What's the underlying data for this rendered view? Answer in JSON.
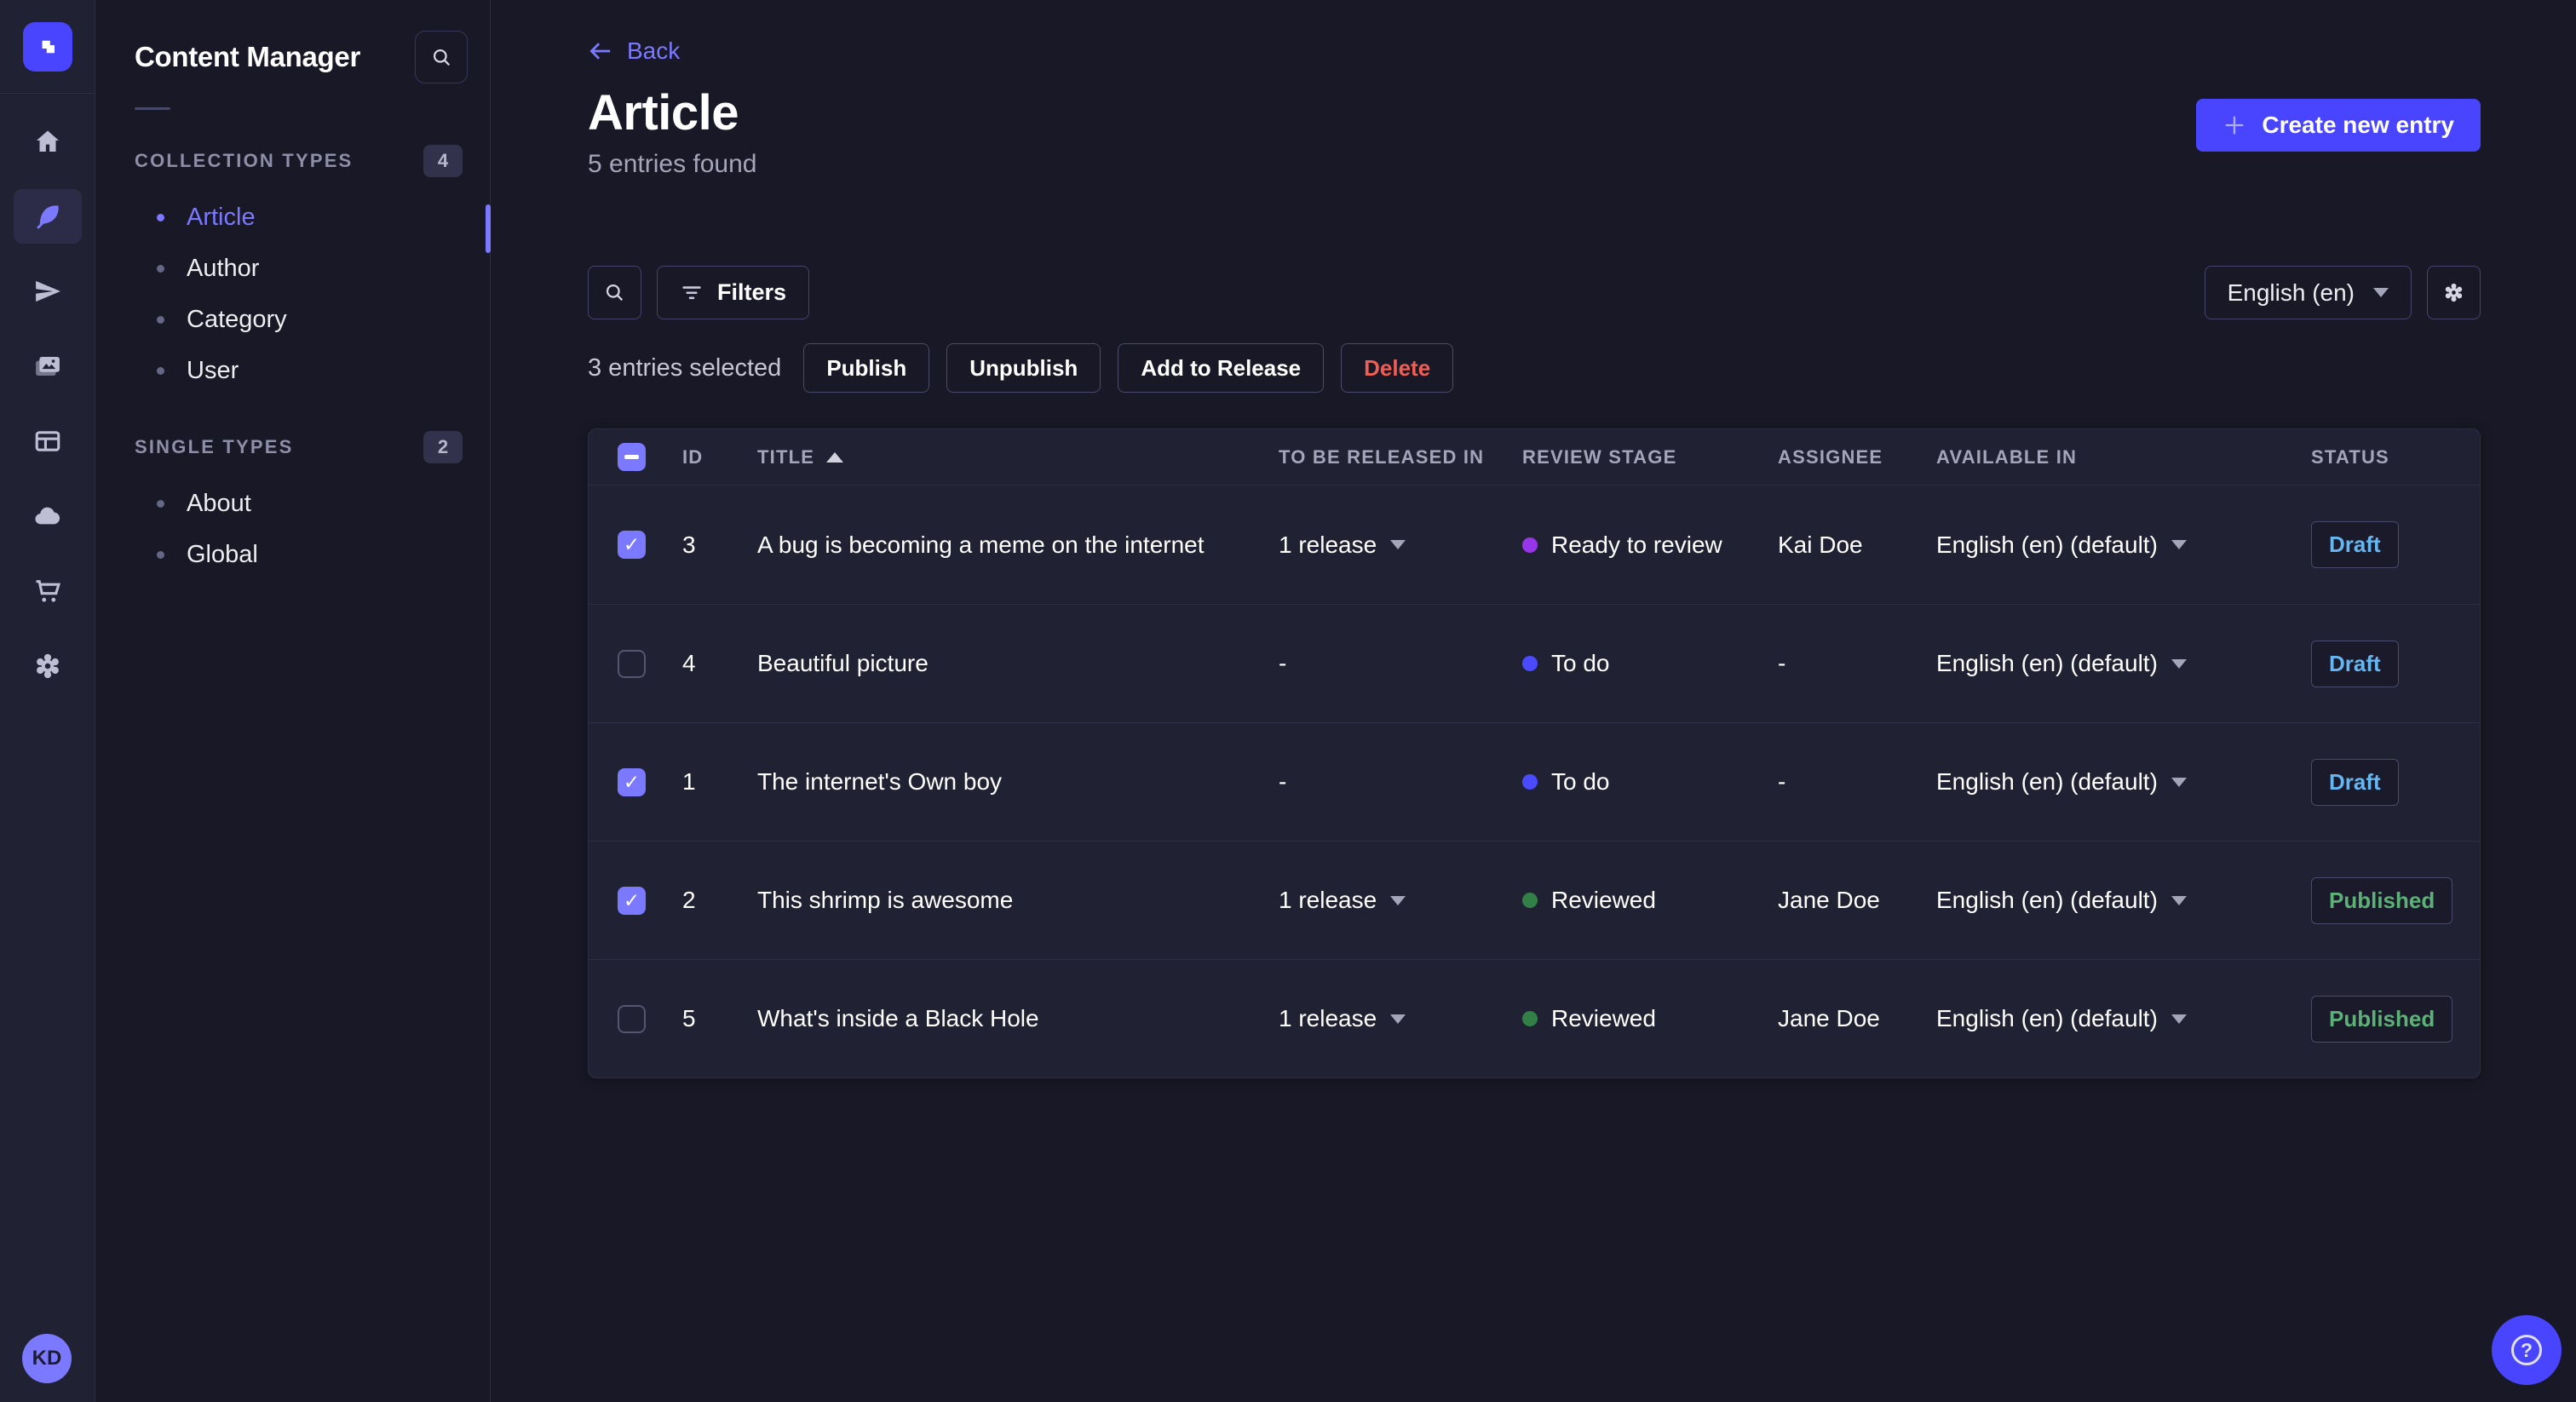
{
  "app": {
    "name": "Content Manager"
  },
  "nav_rail": {
    "logo_icon": "strapi-logo-icon",
    "icons": [
      "home-icon",
      "content-manager-feather-icon",
      "paper-plane-icon",
      "media-library-icon",
      "content-builder-icon",
      "cloud-icon",
      "marketplace-cart-icon",
      "settings-gear-icon"
    ],
    "active_icon": "content-manager-feather-icon",
    "avatar_initials": "KD"
  },
  "sidebar": {
    "title": "Content Manager",
    "search_icon": "search-icon",
    "sections": [
      {
        "label": "COLLECTION TYPES",
        "badge": "4",
        "items": [
          {
            "label": "Article",
            "active": true
          },
          {
            "label": "Author",
            "active": false
          },
          {
            "label": "Category",
            "active": false
          },
          {
            "label": "User",
            "active": false
          }
        ]
      },
      {
        "label": "SINGLE TYPES",
        "badge": "2",
        "items": [
          {
            "label": "About",
            "active": false
          },
          {
            "label": "Global",
            "active": false
          }
        ]
      }
    ]
  },
  "header": {
    "back_label": "Back",
    "title": "Article",
    "subtitle": "5 entries found",
    "create_button_label": "Create new entry"
  },
  "toolbar": {
    "filters_label": "Filters",
    "locale_value": "English (en)"
  },
  "selection": {
    "summary": "3 entries selected",
    "publish_label": "Publish",
    "unpublish_label": "Unpublish",
    "add_to_release_label": "Add to Release",
    "delete_label": "Delete"
  },
  "table": {
    "columns": [
      "ID",
      "TITLE",
      "TO BE RELEASED IN",
      "REVIEW STAGE",
      "ASSIGNEE",
      "AVAILABLE IN",
      "STATUS"
    ],
    "sorted_column": "TITLE",
    "sort_direction": "ascending",
    "header_checkbox_state": "indeterminate",
    "rows": [
      {
        "checked": true,
        "id": "3",
        "title": "A bug is becoming a meme on the internet",
        "released_in": "1 release",
        "review_stage": "Ready to review",
        "stage_color": "#9736e8",
        "assignee": "Kai Doe",
        "available_in": "English (en) (default)",
        "status": "Draft"
      },
      {
        "checked": false,
        "id": "4",
        "title": "Beautiful picture",
        "released_in": "-",
        "review_stage": "To do",
        "stage_color": "#4a4aff",
        "assignee": "-",
        "available_in": "English (en) (default)",
        "status": "Draft"
      },
      {
        "checked": true,
        "id": "1",
        "title": "The internet's Own boy",
        "released_in": "-",
        "review_stage": "To do",
        "stage_color": "#4a4aff",
        "assignee": "-",
        "available_in": "English (en) (default)",
        "status": "Draft"
      },
      {
        "checked": true,
        "id": "2",
        "title": "This shrimp is awesome",
        "released_in": "1 release",
        "review_stage": "Reviewed",
        "stage_color": "#328048",
        "assignee": "Jane Doe",
        "available_in": "English (en) (default)",
        "status": "Published"
      },
      {
        "checked": false,
        "id": "5",
        "title": "What's inside a Black Hole",
        "released_in": "1 release",
        "review_stage": "Reviewed",
        "stage_color": "#328048",
        "assignee": "Jane Doe",
        "available_in": "English (en) (default)",
        "status": "Published"
      }
    ]
  },
  "colors": {
    "brand": "#4945ff",
    "brand_light": "#7b79ff",
    "danger": "#ee5e52",
    "status_draft": "#66b7f1",
    "status_published": "#5cb176",
    "stage_ready_to_review": "#9736e8",
    "stage_to_do": "#4a4aff",
    "stage_reviewed": "#328048"
  },
  "help": {
    "icon": "question-mark-icon"
  }
}
